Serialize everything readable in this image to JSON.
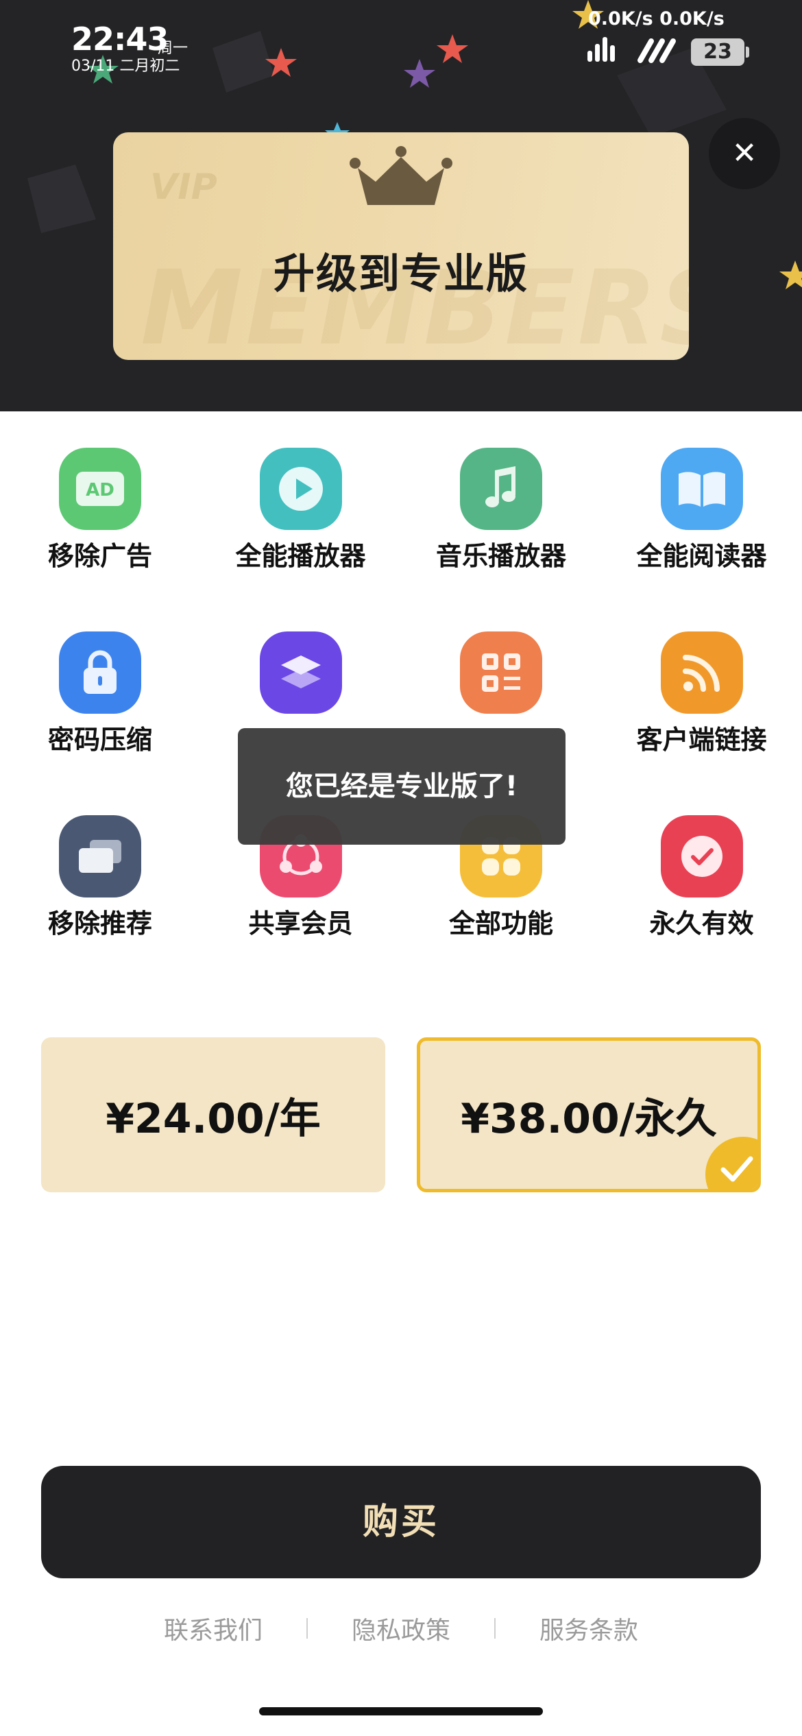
{
  "status_bar": {
    "time": "22:43",
    "weekday": "周一",
    "date": "03/11 二月初二",
    "net_speed": "0.0K/s 0.0K/s",
    "battery": "23"
  },
  "banner": {
    "watermark_vip": "VIP",
    "watermark_membership": "MEMBERSHIP",
    "title": "升级到专业版",
    "close_icon": "close-icon"
  },
  "features": [
    {
      "label": "移除广告",
      "icon": "ad-icon",
      "color": "#5cc873"
    },
    {
      "label": "全能播放器",
      "icon": "play-icon",
      "color": "#43bfc0"
    },
    {
      "label": "音乐播放器",
      "icon": "music-note-icon",
      "color": "#55b586"
    },
    {
      "label": "全能阅读器",
      "icon": "book-icon",
      "color": "#4ea8f2"
    },
    {
      "label": "密码压缩",
      "icon": "lock-icon",
      "color": "#3d83ee"
    },
    {
      "label": "",
      "icon": "layers-icon",
      "color": "#6b47e6"
    },
    {
      "label": "",
      "icon": "qr-code-icon",
      "color": "#ef7f4c"
    },
    {
      "label": "客户端链接",
      "icon": "rss-icon",
      "color": "#f0992a"
    },
    {
      "label": "移除推荐",
      "icon": "windows-icon",
      "color": "#4a5873"
    },
    {
      "label": "共享会员",
      "icon": "share-icon",
      "color": "#ec4b70"
    },
    {
      "label": "全部功能",
      "icon": "apps-icon",
      "color": "#f5be3a"
    },
    {
      "label": "永久有效",
      "icon": "check-circle-icon",
      "color": "#e94154"
    }
  ],
  "toast": "您已经是专业版了!",
  "prices": [
    {
      "label": "¥24.00/年",
      "selected": false
    },
    {
      "label": "¥38.00/永久",
      "selected": true
    }
  ],
  "buy_label": "购买",
  "footer": {
    "contact": "联系我们",
    "privacy": "隐私政策",
    "terms": "服务条款"
  },
  "colors": {
    "header_bg": "#242427",
    "banner_gold": "#ead3a0",
    "accent": "#efbb2a",
    "buy_bg": "#222225",
    "buy_text": "#f3dfb6"
  }
}
